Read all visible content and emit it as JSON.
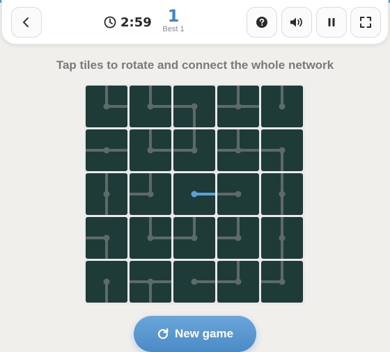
{
  "header": {
    "timer": "2:59",
    "score": "1",
    "best": "Best 1"
  },
  "instruction": "Tap tiles to rotate and connect the whole network",
  "new_game_label": "New game",
  "colors": {
    "accent": "#4f93cf",
    "tile_bg": "#1e3b38",
    "pipe": "#5c6b6a",
    "pipe_active": "#5aa0dc"
  },
  "board": {
    "rows": 5,
    "cols": 5,
    "tiles": [
      [
        {
          "c": "NE",
          "active": false
        },
        {
          "c": "NE",
          "active": false
        },
        {
          "c": "SW",
          "active": false
        },
        {
          "c": "NEW",
          "active": false
        },
        {
          "c": "N",
          "active": false
        }
      ],
      [
        {
          "c": "EW",
          "active": false
        },
        {
          "c": "NE",
          "active": false
        },
        {
          "c": "NW",
          "active": false
        },
        {
          "c": "NEW",
          "active": false
        },
        {
          "c": "SW",
          "active": false
        }
      ],
      [
        {
          "c": "NS",
          "active": false
        },
        {
          "c": "NW",
          "active": false
        },
        {
          "c": "E",
          "active": true
        },
        {
          "c": "W",
          "active": false
        },
        {
          "c": "NS",
          "active": false
        }
      ],
      [
        {
          "c": "SW",
          "active": false
        },
        {
          "c": "NE",
          "active": false
        },
        {
          "c": "NW",
          "active": false
        },
        {
          "c": "NW",
          "active": false
        },
        {
          "c": "NS",
          "active": false
        }
      ],
      [
        {
          "c": "S",
          "active": false
        },
        {
          "c": "SEW",
          "active": false
        },
        {
          "c": "E",
          "active": false
        },
        {
          "c": "NW",
          "active": false
        },
        {
          "c": "NW",
          "active": false
        }
      ]
    ]
  }
}
